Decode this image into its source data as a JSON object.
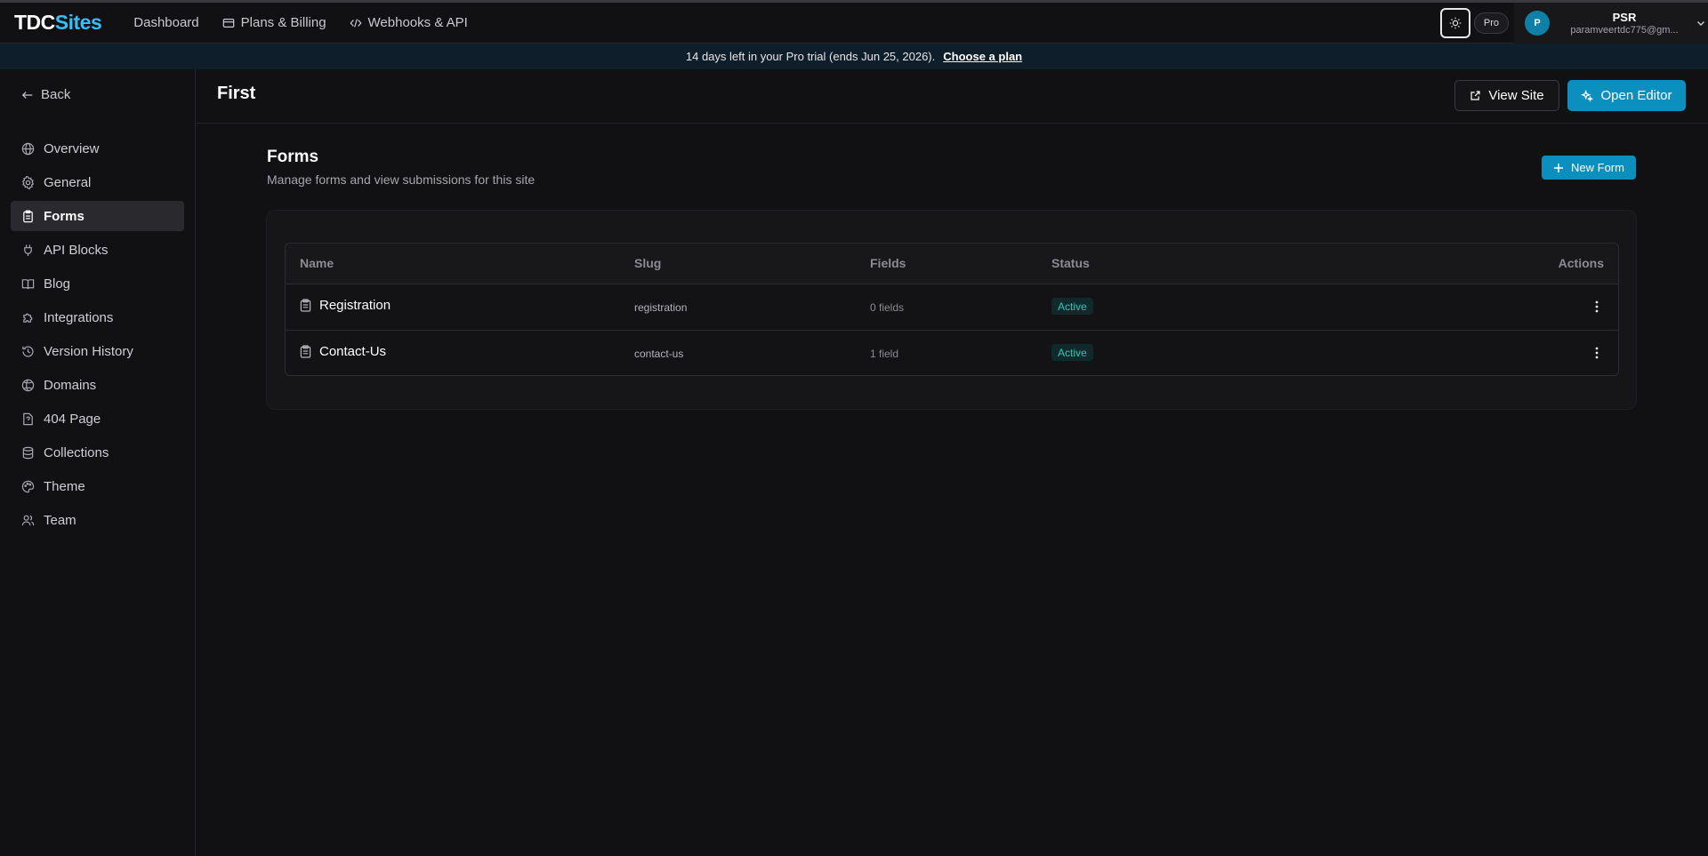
{
  "app": {
    "logo_part1": "TDC",
    "logo_part2": "Sites"
  },
  "topnav": [
    {
      "label": "Dashboard",
      "icon": ""
    },
    {
      "label": "Plans & Billing",
      "icon": "credit-card-icon"
    },
    {
      "label": "Webhooks & API",
      "icon": "code-icon"
    }
  ],
  "header_right": {
    "theme_icon": "sun-icon",
    "plan_badge": "Pro",
    "user": {
      "avatar_initial": "P",
      "name": "PSR",
      "email": "paramveertdc775@gm..."
    }
  },
  "banner": {
    "text": "14 days left in your Pro trial (ends Jun 25, 2026).",
    "cta": "Choose a plan"
  },
  "sidebar": {
    "back_label": "Back",
    "items": [
      {
        "label": "Overview",
        "icon": "globe-icon",
        "active": false
      },
      {
        "label": "General",
        "icon": "gear-icon",
        "active": false
      },
      {
        "label": "Forms",
        "icon": "clipboard-icon",
        "active": true
      },
      {
        "label": "API Blocks",
        "icon": "plug-icon",
        "active": false
      },
      {
        "label": "Blog",
        "icon": "book-icon",
        "active": false
      },
      {
        "label": "Integrations",
        "icon": "puzzle-icon",
        "active": false
      },
      {
        "label": "Version History",
        "icon": "history-icon",
        "active": false
      },
      {
        "label": "Domains",
        "icon": "globe-grid-icon",
        "active": false
      },
      {
        "label": "404 Page",
        "icon": "file-question-icon",
        "active": false
      },
      {
        "label": "Collections",
        "icon": "database-icon",
        "active": false
      },
      {
        "label": "Theme",
        "icon": "palette-icon",
        "active": false
      },
      {
        "label": "Team",
        "icon": "users-icon",
        "active": false
      }
    ]
  },
  "page": {
    "title": "First",
    "view_site_label": "View Site",
    "open_editor_label": "Open Editor"
  },
  "forms": {
    "title": "Forms",
    "description": "Manage forms and view submissions for this site",
    "new_form_label": "New Form",
    "columns": [
      "Name",
      "Slug",
      "Fields",
      "Status",
      "Actions"
    ],
    "rows": [
      {
        "name": "Registration",
        "slug": "registration",
        "fields": "0 fields",
        "status": "Active"
      },
      {
        "name": "Contact-Us",
        "slug": "contact-us",
        "fields": "1 field",
        "status": "Active"
      }
    ]
  },
  "colors": {
    "accent": "#0a8fbf",
    "logo_accent": "#38bdf8",
    "status_active": "#2cc7b4",
    "background": "#111113"
  }
}
